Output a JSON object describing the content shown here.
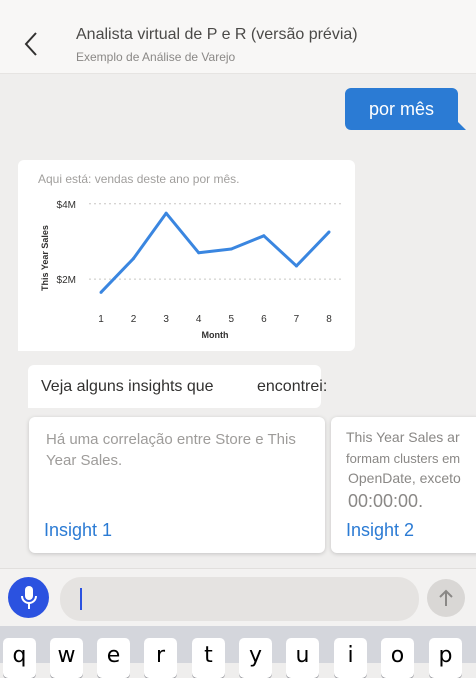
{
  "header": {
    "title": "Analista virtual de P e R (versão prévia)",
    "subtitle": "Exemplo de Análise de Varejo",
    "back_icon": "back-arrow-icon"
  },
  "conversation": {
    "user_message": "por mês",
    "bot_caption": "Aqui está: vendas deste ano por mês.",
    "insights_intro_part1": "Veja alguns insights que",
    "insights_intro_part2": "encontrei:"
  },
  "chart_data": {
    "type": "line",
    "title": "",
    "xlabel": "Month",
    "ylabel": "This Year Sales",
    "x": [
      1,
      2,
      3,
      4,
      5,
      6,
      7,
      8
    ],
    "values": [
      1.65,
      2.55,
      3.75,
      2.7,
      2.8,
      3.15,
      2.35,
      3.25
    ],
    "ylim": [
      1.5,
      4.1
    ],
    "y_ticks": [
      {
        "value": 2,
        "label": "$2M"
      },
      {
        "value": 4,
        "label": "$4M"
      }
    ],
    "grid": "horizontal dashed",
    "line_color": "#3a86e0"
  },
  "insights": [
    {
      "description": "Há uma correlação entre Store e This Year Sales.",
      "link_label": "Insight 1"
    },
    {
      "title": "This Year Sales ar",
      "line2": "formam clusters em",
      "line3": "OpenDate, exceto",
      "line4": "00:00:00.",
      "link_label": "Insight 2"
    }
  ],
  "input": {
    "placeholder": "",
    "mic_icon": "microphone-icon",
    "send_icon": "send-arrow-icon"
  },
  "keyboard": {
    "keys": [
      "q",
      "w",
      "e",
      "r",
      "t",
      "y",
      "u",
      "i",
      "o",
      "p"
    ]
  },
  "colors": {
    "accent": "#2b7bd4",
    "mic": "#2b52e0",
    "background": "#efeeed"
  }
}
